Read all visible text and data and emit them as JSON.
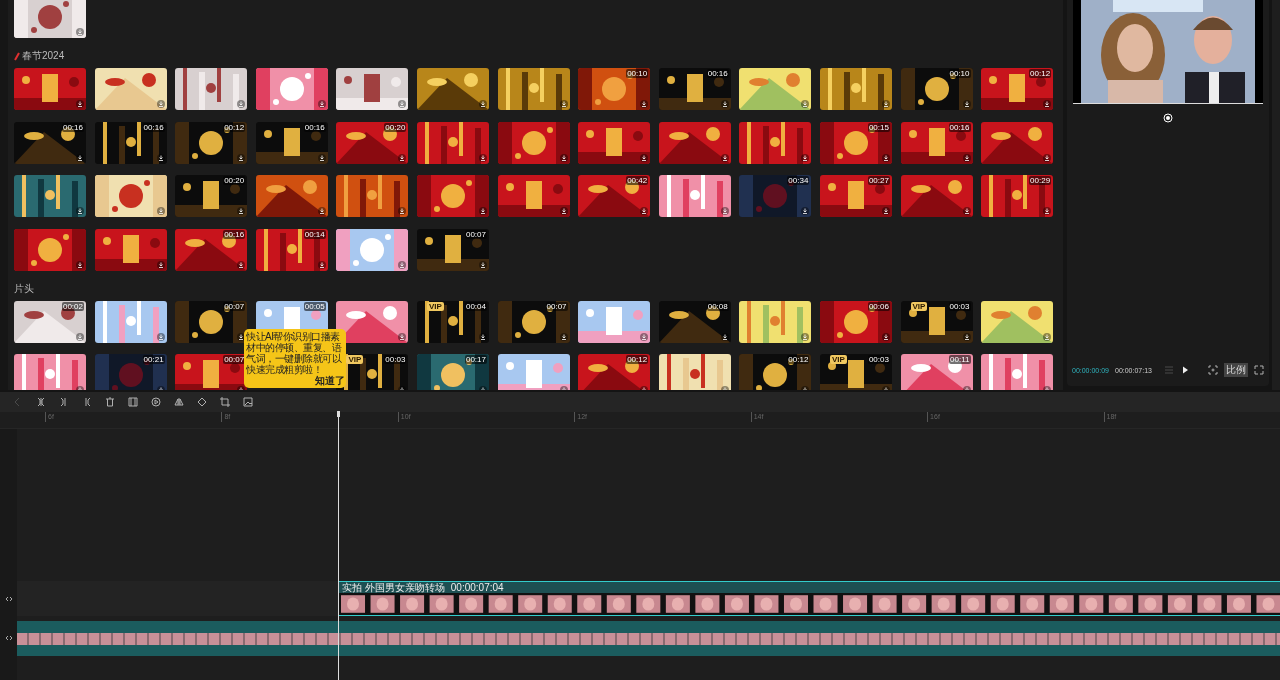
{
  "library": {
    "sections": [
      {
        "items": [
          {
            "kind": "picture"
          }
        ]
      },
      {
        "title": "春节2024",
        "has_icon": true,
        "items": [
          {
            "kind": "picture"
          },
          {
            "kind": "picture"
          },
          {
            "kind": "picture"
          },
          {
            "kind": "picture"
          },
          {
            "kind": "picture"
          },
          {
            "kind": "picture"
          },
          {
            "kind": "picture"
          },
          {
            "kind": "picture",
            "duration": "00:10"
          },
          {
            "kind": "picture",
            "duration": "00:16"
          },
          {
            "kind": "picture"
          },
          {
            "kind": "picture"
          },
          {
            "kind": "picture",
            "duration": "00:10"
          },
          {
            "kind": "picture",
            "duration": "00:12"
          },
          {
            "kind": "picture",
            "duration": "00:16"
          },
          {
            "kind": "picture",
            "duration": "00:16"
          },
          {
            "kind": "picture",
            "duration": "00:12"
          },
          {
            "kind": "picture",
            "duration": "00:16"
          },
          {
            "kind": "picture",
            "duration": "00:20"
          },
          {
            "kind": "picture"
          },
          {
            "kind": "picture"
          },
          {
            "kind": "picture"
          },
          {
            "kind": "picture"
          },
          {
            "kind": "picture"
          },
          {
            "kind": "picture",
            "duration": "00:15"
          },
          {
            "kind": "picture",
            "duration": "00:16"
          },
          {
            "kind": "picture"
          },
          {
            "kind": "picture"
          },
          {
            "kind": "picture"
          },
          {
            "kind": "picture",
            "duration": "00:20"
          },
          {
            "kind": "picture"
          },
          {
            "kind": "picture"
          },
          {
            "kind": "picture"
          },
          {
            "kind": "picture"
          },
          {
            "kind": "picture",
            "duration": "00:42"
          },
          {
            "kind": "picture"
          },
          {
            "kind": "picture",
            "duration": "00:34"
          },
          {
            "kind": "picture",
            "duration": "00:27"
          },
          {
            "kind": "picture"
          },
          {
            "kind": "picture",
            "duration": "00:29"
          },
          {
            "kind": "picture"
          },
          {
            "kind": "picture"
          },
          {
            "kind": "picture",
            "duration": "00:16"
          },
          {
            "kind": "picture",
            "duration": "00:14"
          },
          {
            "kind": "picture"
          },
          {
            "kind": "picture",
            "duration": "00:07"
          }
        ]
      },
      {
        "title": "片头",
        "items": [
          {
            "kind": "picture",
            "duration": "00:02"
          },
          {
            "kind": "picture"
          },
          {
            "kind": "picture",
            "duration": "00:07"
          },
          {
            "kind": "picture",
            "duration": "00:05",
            "download": false
          },
          {
            "kind": "picture"
          },
          {
            "kind": "picture",
            "duration": "00:04",
            "vip": "VIP"
          },
          {
            "kind": "picture",
            "duration": "00:07"
          },
          {
            "kind": "picture"
          },
          {
            "kind": "picture",
            "duration": "00:08"
          },
          {
            "kind": "picture"
          },
          {
            "kind": "picture",
            "duration": "00:06"
          },
          {
            "kind": "picture",
            "duration": "00:03",
            "vip": "VIP"
          },
          {
            "kind": "picture"
          },
          {
            "kind": "picture"
          },
          {
            "kind": "picture",
            "duration": "00:21"
          },
          {
            "kind": "picture",
            "duration": "00:07"
          },
          {
            "kind": "covered"
          },
          {
            "kind": "picture",
            "duration": "00:03",
            "vip": "VIP"
          },
          {
            "kind": "picture",
            "duration": "00:17"
          },
          {
            "kind": "picture"
          },
          {
            "kind": "picture",
            "duration": "00:12"
          },
          {
            "kind": "picture"
          },
          {
            "kind": "picture",
            "duration": "00:12"
          },
          {
            "kind": "picture",
            "duration": "00:03",
            "vip": "VIP"
          },
          {
            "kind": "picture",
            "duration": "00:11"
          },
          {
            "kind": "picture"
          }
        ]
      }
    ]
  },
  "tooltip": {
    "text": "快让AI帮你识别口播素材中的停顿、重复、语气词，一键删除就可以快速完成粗剪啦！",
    "button": "知道了"
  },
  "preview": {
    "current_time": "00:00:00:09",
    "total_time": "00:00:07:13",
    "ratio_button": "比例"
  },
  "toolbar": {
    "undo_disabled": true
  },
  "ruler": [
    "6f",
    "8f",
    "10f",
    "12f",
    "14f",
    "16f",
    "18f"
  ],
  "tracks": [
    {
      "kind": "video",
      "clip_title": "实拍 外国男女亲吻转场",
      "clip_duration": "00:00:07:04"
    },
    {
      "kind": "audio"
    }
  ]
}
